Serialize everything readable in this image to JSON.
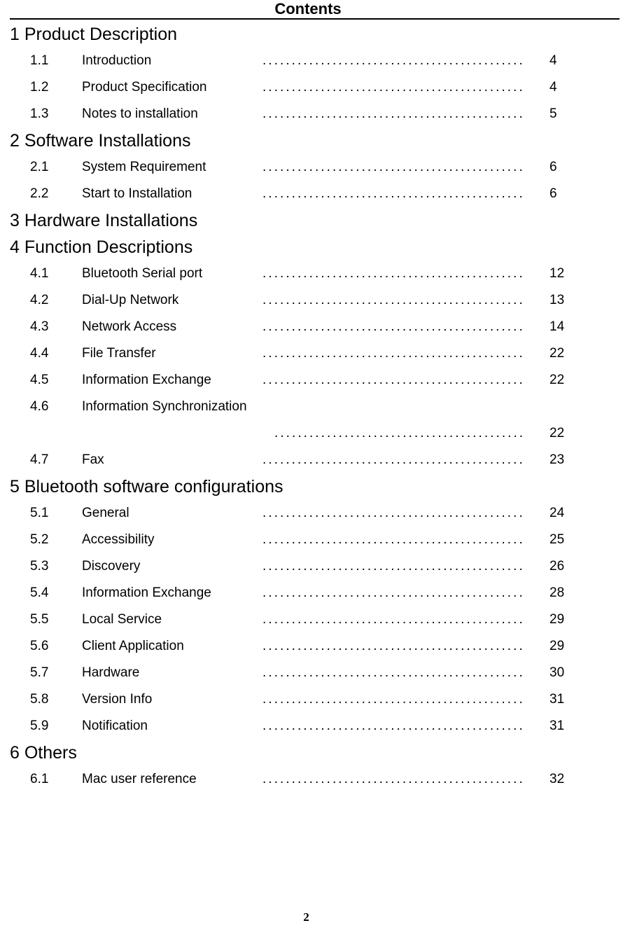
{
  "document": {
    "title": "Contents",
    "page_number": "2",
    "leader_dots": "...................................................."
  },
  "toc": {
    "sections": [
      {
        "heading": "1 Product Description",
        "entries": [
          {
            "number": "1.1",
            "title": "Introduction",
            "page": "4",
            "wrapped": false
          },
          {
            "number": "1.2",
            "title": "Product Specification",
            "page": "4",
            "wrapped": false
          },
          {
            "number": "1.3",
            "title": "Notes to installation",
            "page": "5",
            "wrapped": false
          }
        ]
      },
      {
        "heading": "2 Software Installations",
        "entries": [
          {
            "number": "2.1",
            "title": "System Requirement",
            "page": "6",
            "wrapped": false
          },
          {
            "number": "2.2",
            "title": "Start to Installation",
            "page": "6",
            "wrapped": false
          }
        ]
      },
      {
        "heading": "3 Hardware Installations",
        "entries": []
      },
      {
        "heading": "4 Function Descriptions",
        "entries": [
          {
            "number": "4.1",
            "title": "Bluetooth Serial port",
            "page": "12",
            "wrapped": false
          },
          {
            "number": "4.2",
            "title": "Dial-Up Network",
            "page": "13",
            "wrapped": false
          },
          {
            "number": "4.3",
            "title": "Network Access",
            "page": "14",
            "wrapped": false
          },
          {
            "number": "4.4",
            "title": "File Transfer",
            "page": "22",
            "wrapped": false
          },
          {
            "number": "4.5",
            "title": "Information Exchange",
            "page": "22",
            "wrapped": false
          },
          {
            "number": "4.6",
            "title": "Information Synchronization",
            "page": "22",
            "wrapped": true
          },
          {
            "number": "4.7",
            "title": "Fax",
            "page": "23",
            "wrapped": false
          }
        ]
      },
      {
        "heading": "5 Bluetooth software configurations",
        "entries": [
          {
            "number": "5.1",
            "title": "General",
            "page": "24",
            "wrapped": false
          },
          {
            "number": "5.2",
            "title": "Accessibility",
            "page": "25",
            "wrapped": false
          },
          {
            "number": "5.3",
            "title": "Discovery",
            "page": "26",
            "wrapped": false
          },
          {
            "number": "5.4",
            "title": "Information Exchange",
            "page": "28",
            "wrapped": false
          },
          {
            "number": "5.5",
            "title": "Local Service",
            "page": "29",
            "wrapped": false
          },
          {
            "number": "5.6",
            "title": "Client Application",
            "page": "29",
            "wrapped": false
          },
          {
            "number": "5.7",
            "title": "Hardware",
            "page": "30",
            "wrapped": false
          },
          {
            "number": "5.8",
            "title": "Version Info",
            "page": "31",
            "wrapped": false
          },
          {
            "number": "5.9",
            "title": "Notification",
            "page": "31",
            "wrapped": false
          }
        ]
      },
      {
        "heading": "6 Others",
        "entries": [
          {
            "number": "6.1",
            "title": "Mac user reference",
            "page": "32",
            "wrapped": false
          }
        ]
      }
    ]
  }
}
